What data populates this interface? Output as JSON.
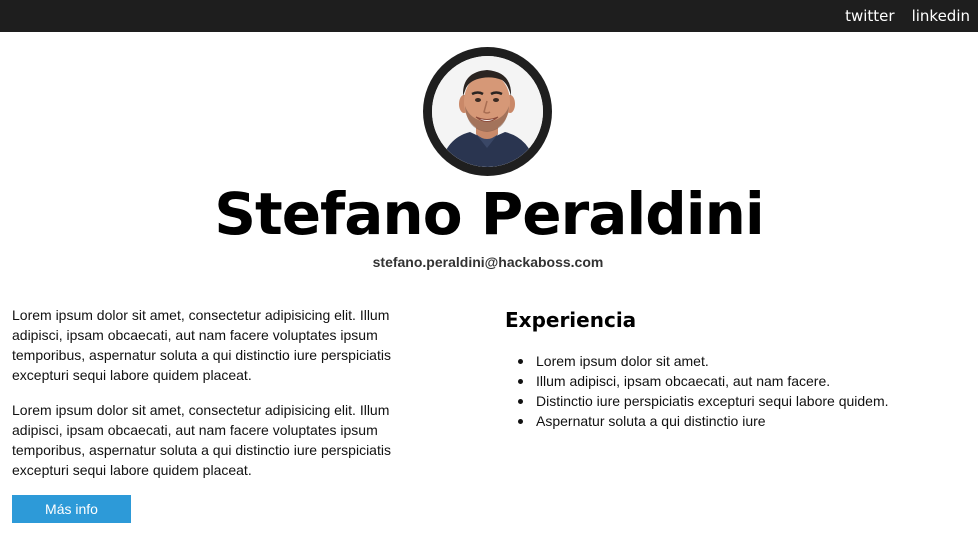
{
  "nav": {
    "links": [
      {
        "label": "twitter"
      },
      {
        "label": "linkedin"
      }
    ]
  },
  "profile": {
    "name": "Stefano Peraldini",
    "email": "stefano.peraldini@hackaboss.com"
  },
  "about": {
    "paragraphs": [
      "Lorem ipsum dolor sit amet, consectetur adipisicing elit. Illum adipisci, ipsam obcaecati, aut nam facere voluptates ipsum temporibus, aspernatur soluta a qui distinctio iure perspiciatis excepturi sequi labore quidem placeat.",
      "Lorem ipsum dolor sit amet, consectetur adipisicing elit. Illum adipisci, ipsam obcaecati, aut nam facere voluptates ipsum temporibus, aspernatur soluta a qui distinctio iure perspiciatis excepturi sequi labore quidem placeat."
    ],
    "button_label": "Más info"
  },
  "experience": {
    "title": "Experiencia",
    "items": [
      "Lorem ipsum dolor sit amet.",
      "Illum adipisci, ipsam obcaecati, aut nam facere.",
      "Distinctio iure perspiciatis excepturi sequi labore quidem.",
      "Aspernatur soluta a qui distinctio iure"
    ]
  },
  "colors": {
    "topbar": "#1e1e1e",
    "button": "#2d9ad8",
    "avatar_ring": "#1f1f1f"
  },
  "icons": {
    "avatar": "profile-photo"
  }
}
